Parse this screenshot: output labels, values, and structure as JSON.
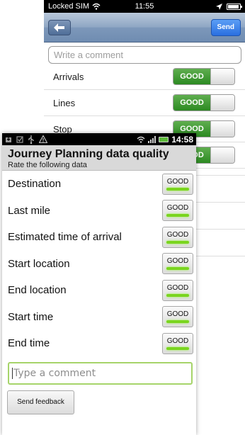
{
  "ios": {
    "status": {
      "carrier": "Locked SIM",
      "time": "11:55"
    },
    "navbar": {
      "back_icon": "arrow-left-icon",
      "send_label": "Send"
    },
    "comment_placeholder": "Write a comment",
    "rows": [
      {
        "label": "Arrivals",
        "value": "GOOD"
      },
      {
        "label": "Lines",
        "value": "GOOD"
      },
      {
        "label": "Stop",
        "value": "GOOD"
      },
      {
        "label": "",
        "value": "GOOD"
      }
    ]
  },
  "android": {
    "status": {
      "time": "14:58"
    },
    "title": "Journey Planning data quality",
    "subtitle": "Rate the following data",
    "rows": [
      {
        "label": "Destination",
        "value": "GOOD"
      },
      {
        "label": "Last mile",
        "value": "GOOD"
      },
      {
        "label": "Estimated time of arrival",
        "value": "GOOD"
      },
      {
        "label": "Start location",
        "value": "GOOD"
      },
      {
        "label": "End location",
        "value": "GOOD"
      },
      {
        "label": "Start time",
        "value": "GOOD"
      },
      {
        "label": "End time",
        "value": "GOOD"
      }
    ],
    "comment_placeholder": "Type a comment",
    "send_label": "Send feedback"
  },
  "colors": {
    "ios_switch_green": "#2c8a22",
    "android_indicator_green": "#7ad51f",
    "android_comment_border": "#a6d46a"
  }
}
